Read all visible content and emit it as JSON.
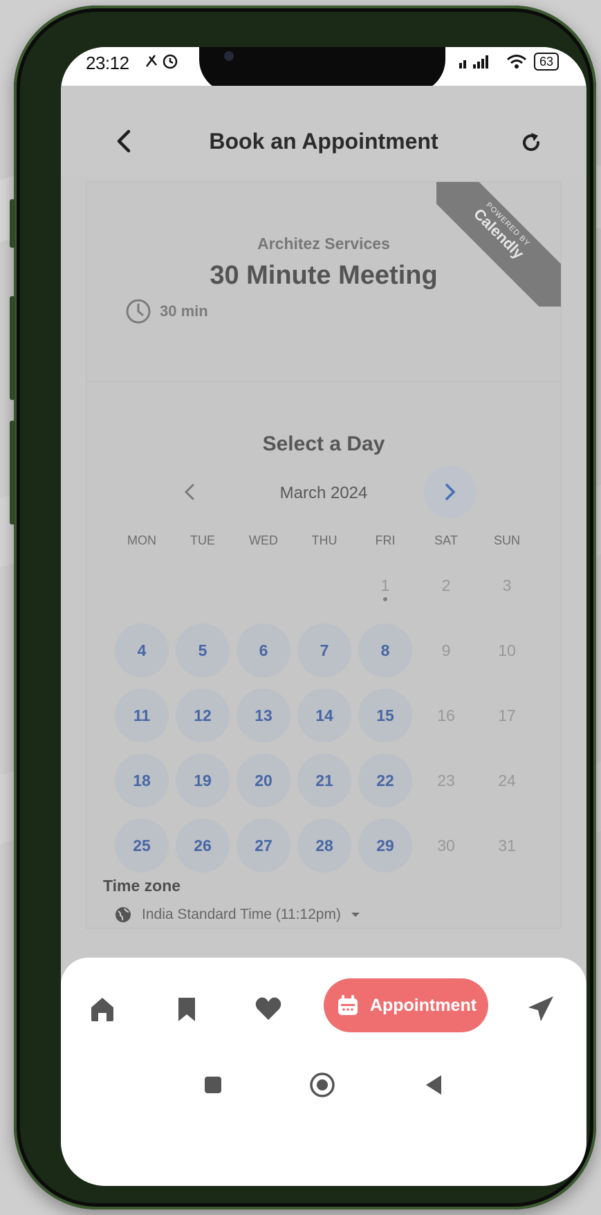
{
  "status_bar": {
    "time": "23:12",
    "battery": "63"
  },
  "header": {
    "title": "Book an Appointment"
  },
  "event": {
    "org": "Architez Services",
    "title": "30 Minute Meeting",
    "duration": "30 min",
    "badge_small": "POWERED BY",
    "badge_brand": "Calendly"
  },
  "calendar": {
    "heading": "Select a Day",
    "month": "March 2024",
    "weekdays": [
      "MON",
      "TUE",
      "WED",
      "THU",
      "FRI",
      "SAT",
      "SUN"
    ],
    "days": [
      {
        "label": "",
        "available": false
      },
      {
        "label": "",
        "available": false
      },
      {
        "label": "",
        "available": false
      },
      {
        "label": "",
        "available": false
      },
      {
        "label": "1",
        "available": false,
        "today": true
      },
      {
        "label": "2",
        "available": false
      },
      {
        "label": "3",
        "available": false
      },
      {
        "label": "4",
        "available": true
      },
      {
        "label": "5",
        "available": true
      },
      {
        "label": "6",
        "available": true
      },
      {
        "label": "7",
        "available": true
      },
      {
        "label": "8",
        "available": true
      },
      {
        "label": "9",
        "available": false
      },
      {
        "label": "10",
        "available": false
      },
      {
        "label": "11",
        "available": true
      },
      {
        "label": "12",
        "available": true
      },
      {
        "label": "13",
        "available": true
      },
      {
        "label": "14",
        "available": true
      },
      {
        "label": "15",
        "available": true
      },
      {
        "label": "16",
        "available": false
      },
      {
        "label": "17",
        "available": false
      },
      {
        "label": "18",
        "available": true
      },
      {
        "label": "19",
        "available": true
      },
      {
        "label": "20",
        "available": true
      },
      {
        "label": "21",
        "available": true
      },
      {
        "label": "22",
        "available": true
      },
      {
        "label": "23",
        "available": false
      },
      {
        "label": "24",
        "available": false
      },
      {
        "label": "25",
        "available": true
      },
      {
        "label": "26",
        "available": true
      },
      {
        "label": "27",
        "available": true
      },
      {
        "label": "28",
        "available": true
      },
      {
        "label": "29",
        "available": true
      },
      {
        "label": "30",
        "available": false
      },
      {
        "label": "31",
        "available": false
      }
    ]
  },
  "timezone": {
    "label": "Time zone",
    "value": "India Standard Time (11:12pm)"
  },
  "nav": {
    "items": [
      "home-icon",
      "bookmark-icon",
      "heart-icon",
      "appointment",
      "send-icon"
    ],
    "appointment_label": "Appointment"
  },
  "colors": {
    "accent": "#ef6f71",
    "available_day": "#4867a4",
    "overlay": "#c8c8c8"
  }
}
